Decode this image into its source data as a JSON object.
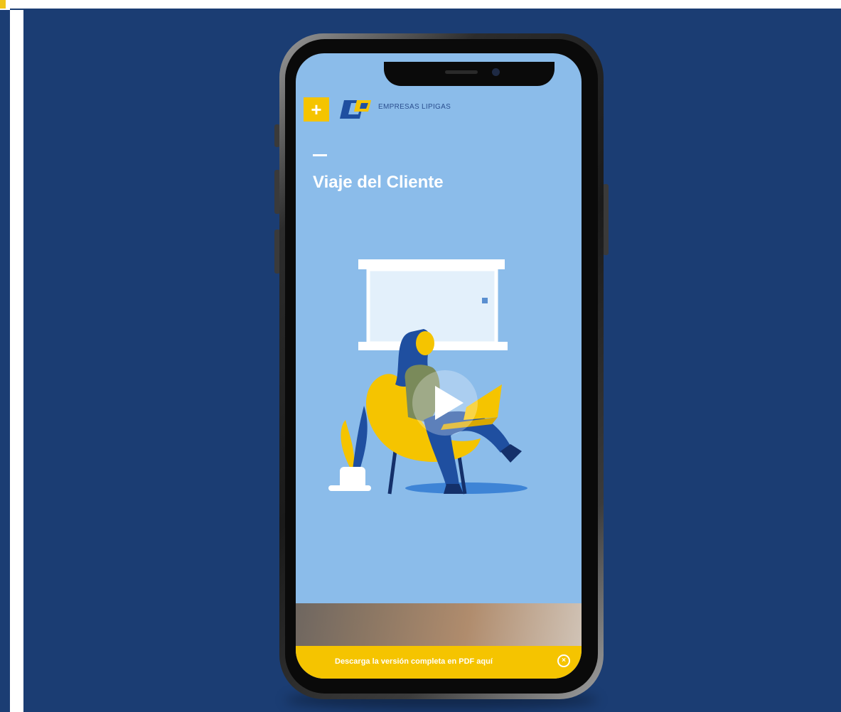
{
  "page": {
    "title": "Viaje del Cliente",
    "brand_name": "EMPRESAS LIPIGAS",
    "pdf_banner_text": "Descarga la versión completa en PDF aquí",
    "menu_button_symbol": "+",
    "close_symbol": "×"
  },
  "icons": {
    "menu": "plus-icon",
    "logo": "brand-logo",
    "play": "play-icon",
    "close": "close-icon"
  },
  "colors": {
    "background": "#1b3d73",
    "screen": "#8bbcea",
    "accent": "#f5c400",
    "brand_blue": "#1f4fa0",
    "text": "#ffffff"
  }
}
